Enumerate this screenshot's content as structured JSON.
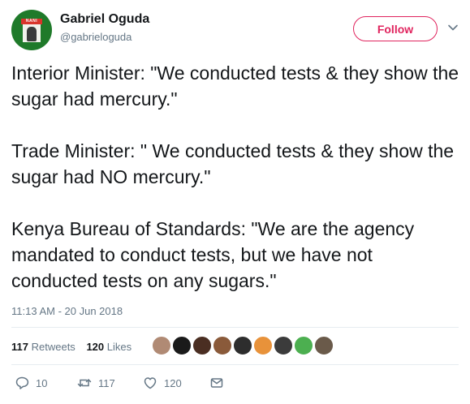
{
  "user": {
    "name": "Gabriel Oguda",
    "handle": "@gabrieloguda",
    "avatar_badge": "NANI"
  },
  "follow_label": "Follow",
  "tweet": {
    "text": "Interior Minister: \"We conducted tests & they show the sugar had mercury.\"\n\nTrade Minister: \" We conducted tests & they show the sugar had NO mercury.\"\n\nKenya Bureau of Standards: \"We are the agency mandated to conduct tests, but we have not conducted tests on any sugars.\"",
    "timestamp": "11:13 AM - 20 Jun 2018"
  },
  "stats": {
    "retweets_count": "117",
    "retweets_label": "Retweets",
    "likes_count": "120",
    "likes_label": "Likes"
  },
  "likers": [
    {
      "color": "#b08a74"
    },
    {
      "color": "#1a1a1a"
    },
    {
      "color": "#4a2e22"
    },
    {
      "color": "#8a5a3a"
    },
    {
      "color": "#2d2d2d"
    },
    {
      "color": "#e8923a"
    },
    {
      "color": "#3b3b3b"
    },
    {
      "color": "#4caf50"
    },
    {
      "color": "#6a5a4a"
    }
  ],
  "actions": {
    "reply_count": "10",
    "retweet_count": "117",
    "like_count": "120"
  },
  "colors": {
    "accent": "#e0245e",
    "muted": "#657786",
    "text": "#14171a"
  }
}
